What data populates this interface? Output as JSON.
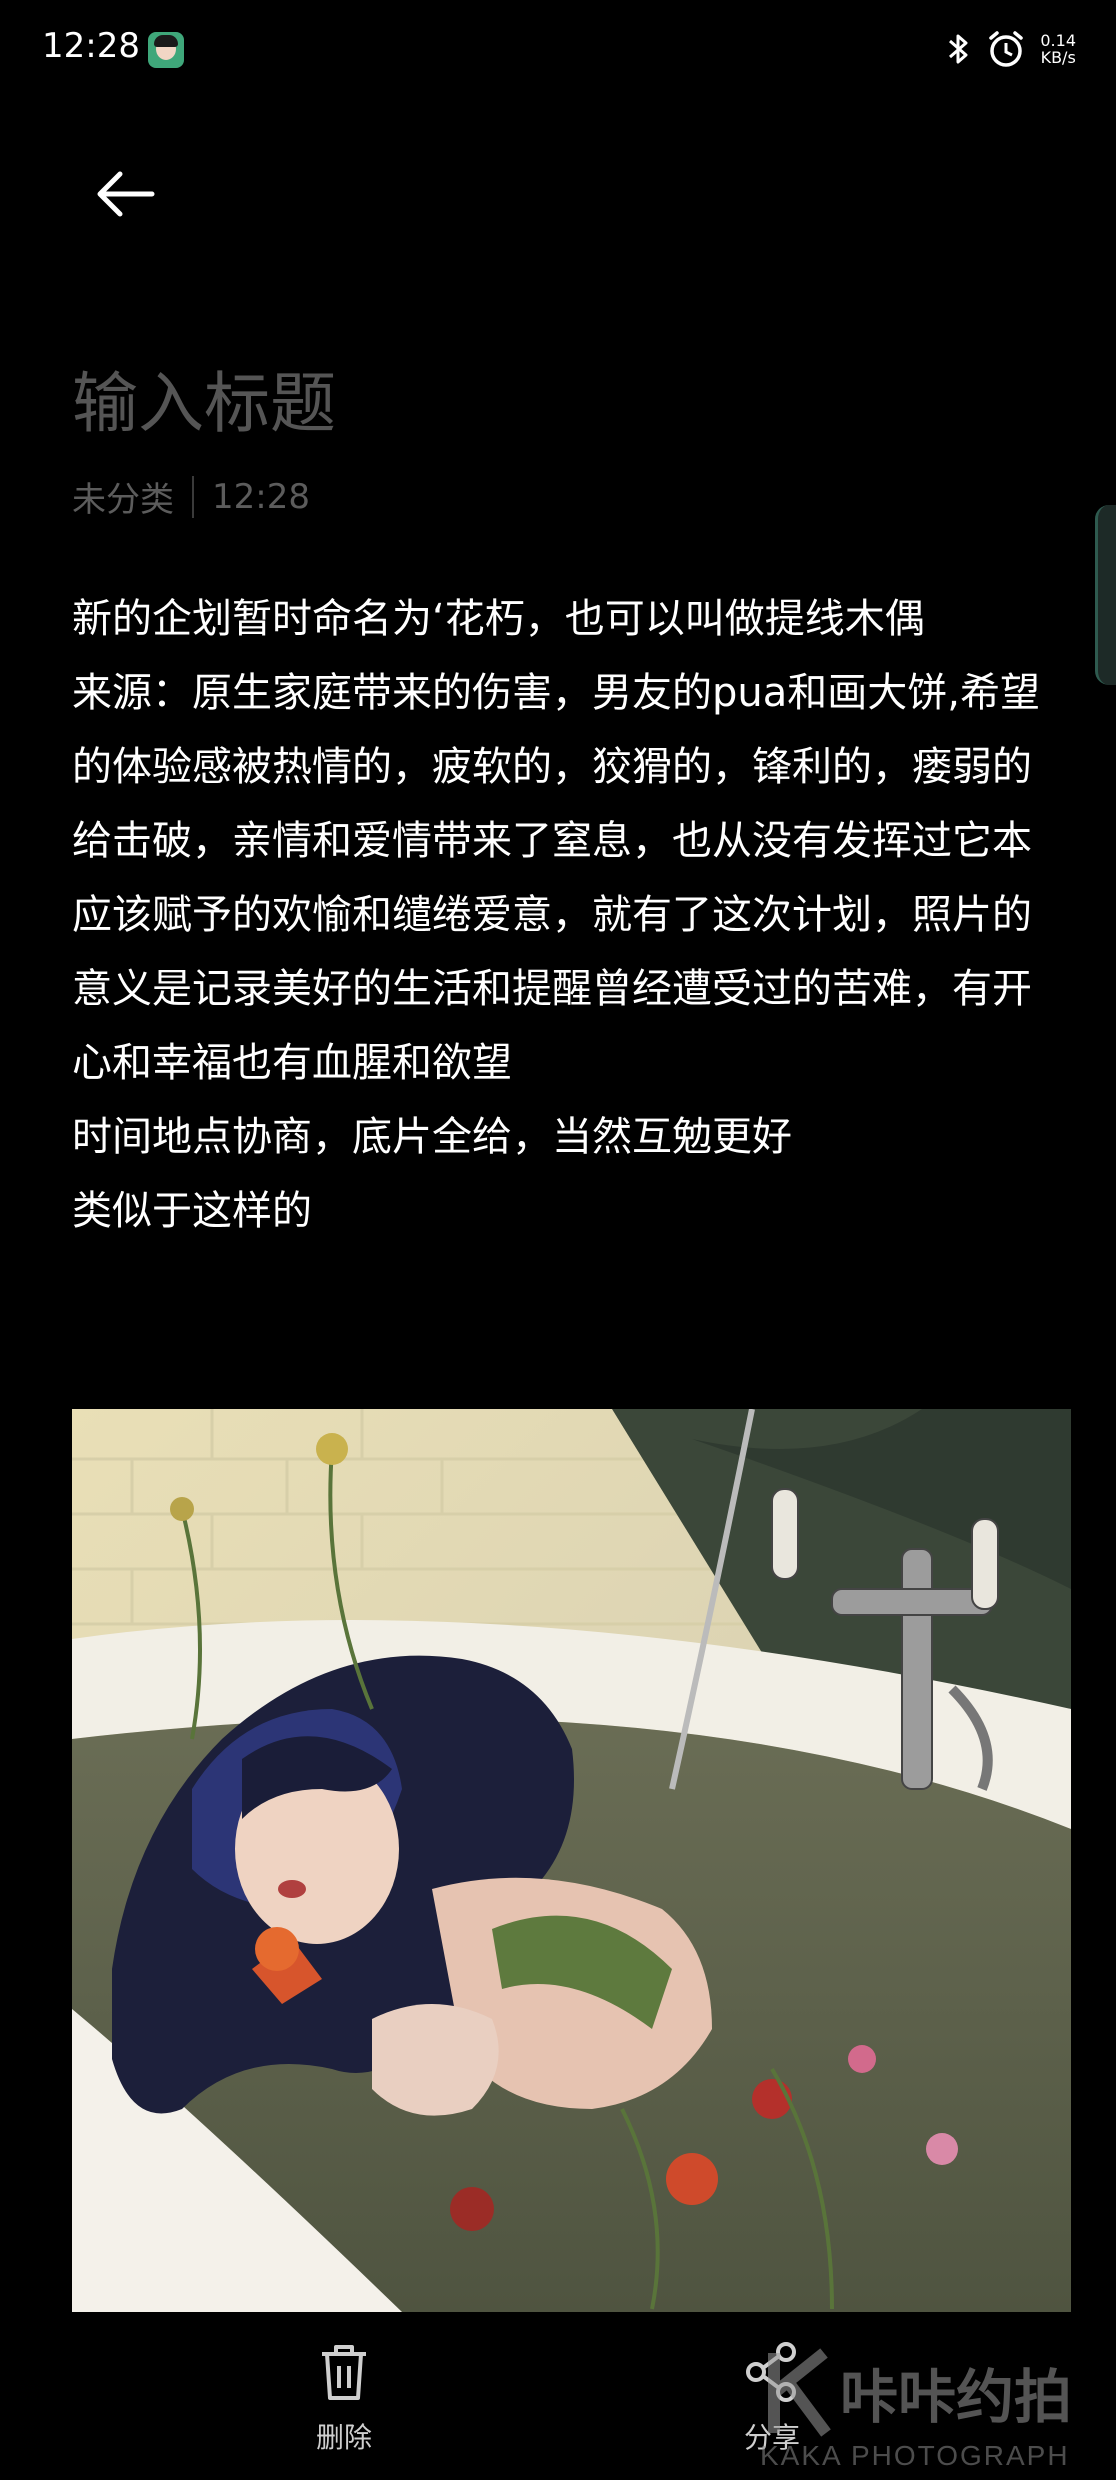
{
  "status_bar": {
    "time": "12:28",
    "net_speed_value": "0.14",
    "net_speed_unit": "KB/s"
  },
  "note": {
    "title_placeholder": "输入标题",
    "category": "未分类",
    "time": "12:28",
    "paragraphs": [
      "新的企划暂时命名为‘花朽，也可以叫做提线木偶",
      "来源：原生家庭带来的伤害，男友的pua和画大饼,希望的体验感被热情的，疲软的，狡猾的，锋利的，瘘弱的给击破，亲情和爱情带来了窒息，也从没有发挥过它本应该赋予的欢愉和缱绻爱意，就有了这次计划，照片的意义是记录美好的生活和提醒曾经遭受过的苦难，有开心和幸福也有血腥和欲望",
      "时间地点协商，底片全给，当然互勉更好",
      "类似于这样的"
    ]
  },
  "bottom_bar": {
    "delete_label": "删除",
    "share_label": "分享"
  },
  "watermark": {
    "text": "咔咔约拍",
    "sub": "KAKA PHOTOGRAPH"
  }
}
